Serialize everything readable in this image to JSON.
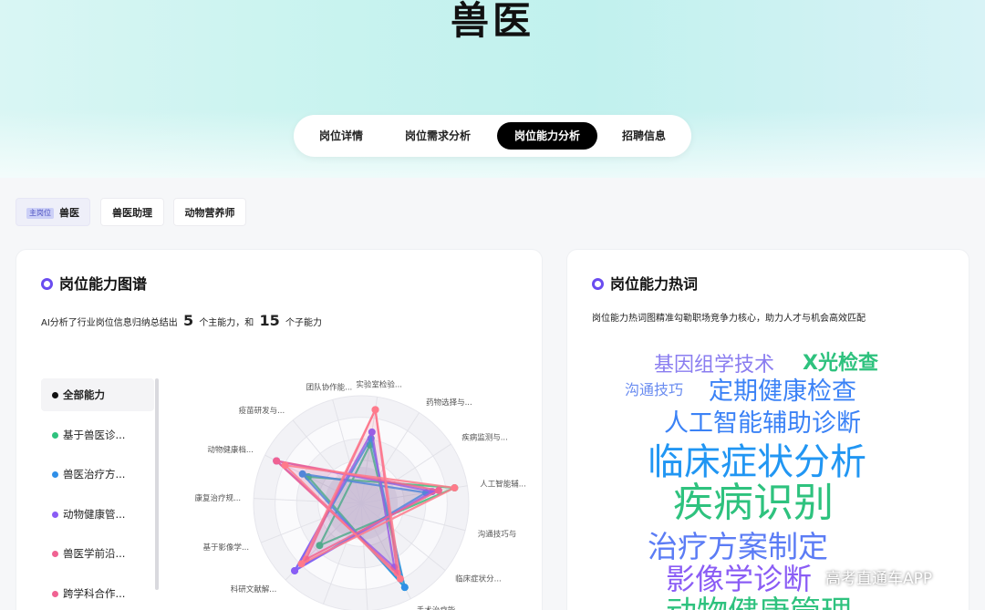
{
  "page": {
    "title": "兽医"
  },
  "tabs": [
    {
      "label": "岗位详情",
      "active": false
    },
    {
      "label": "岗位需求分析",
      "active": false
    },
    {
      "label": "岗位能力分析",
      "active": true
    },
    {
      "label": "招聘信息",
      "active": false
    }
  ],
  "job_pills": {
    "main_badge": "主岗位",
    "main": "兽医",
    "others": [
      "兽医助理",
      "动物营养师"
    ]
  },
  "ability_map": {
    "title": "岗位能力图谱",
    "summary_prefix": "AI分析了行业岗位信息归纳总结出",
    "main_count": "5",
    "summary_mid": "个主能力，和",
    "sub_count": "15",
    "summary_suffix": "个子能力",
    "categories": [
      {
        "label": "全部能力",
        "color": "#111111",
        "active": true
      },
      {
        "label": "基于兽医诊...",
        "color": "#2ec27e",
        "active": false
      },
      {
        "label": "兽医治疗方...",
        "color": "#2f8fe8",
        "active": false
      },
      {
        "label": "动物健康管...",
        "color": "#8a5cf5",
        "active": false
      },
      {
        "label": "兽医学前沿...",
        "color": "#f06292",
        "active": false
      },
      {
        "label": "跨学科合作...",
        "color": "#f06292",
        "active": false
      }
    ],
    "radar_axes": [
      "实验室检验...",
      "药物选择与...",
      "疾病监测与...",
      "人工智能辅...",
      "沟通技巧与",
      "临床症状分...",
      "手术治疗能...",
      "",
      "",
      "科研文献解...",
      "基于影像学...",
      "康复治疗规...",
      "动物健康档...",
      "疫苗研发与...",
      "团队协作能..."
    ],
    "series_colors": [
      "#2ec27e",
      "#2f8fe8",
      "#8a5cf5",
      "#f06292",
      "#ff7a8a"
    ]
  },
  "hot_words": {
    "title": "岗位能力热词",
    "subtitle": "岗位能力热词图精准勾勒职场竞争力核心，助力人才与机会高效匹配",
    "words": [
      {
        "text": "基因组学技术",
        "color": "#8a7df0"
      },
      {
        "text": "X光检查",
        "color": "#2ec27e"
      },
      {
        "text": "沟通技巧",
        "color": "#6a8cf0"
      },
      {
        "text": "定期健康检查",
        "color": "#3b82f6"
      },
      {
        "text": "人工智能辅助诊断",
        "color": "#3b82f6"
      },
      {
        "text": "临床症状分析",
        "color": "#2196f3"
      },
      {
        "text": "疾病识别",
        "color": "#2ec27e"
      },
      {
        "text": "治疗方案制定",
        "color": "#5b7cf5"
      },
      {
        "text": "影像学诊断",
        "color": "#8a5cf5"
      },
      {
        "text": "动物健康管理",
        "color": "#2ec27e"
      }
    ]
  },
  "watermark": "高考直通车APP"
}
